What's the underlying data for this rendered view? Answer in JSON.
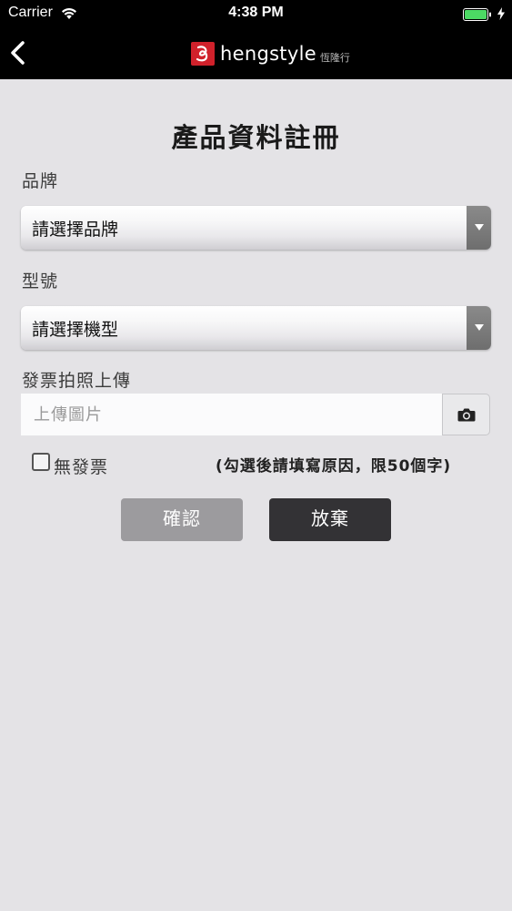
{
  "status_bar": {
    "carrier": "Carrier",
    "time": "4:38 PM"
  },
  "nav": {
    "brand": "hengstyle",
    "brand_cn": "恆隆行",
    "brand_color": "#d0212b"
  },
  "form": {
    "title": "產品資料註冊",
    "brand_label": "品牌",
    "brand_select": "請選擇品牌",
    "model_label": "型號",
    "model_select": "請選擇機型",
    "invoice_label": "發票拍照上傳",
    "upload_placeholder": "上傳圖片",
    "no_invoice_label": "無發票",
    "no_invoice_checked": false,
    "hint": "(勾選後請填寫原因，限50個字)",
    "confirm_label": "確認",
    "cancel_label": "放棄"
  }
}
